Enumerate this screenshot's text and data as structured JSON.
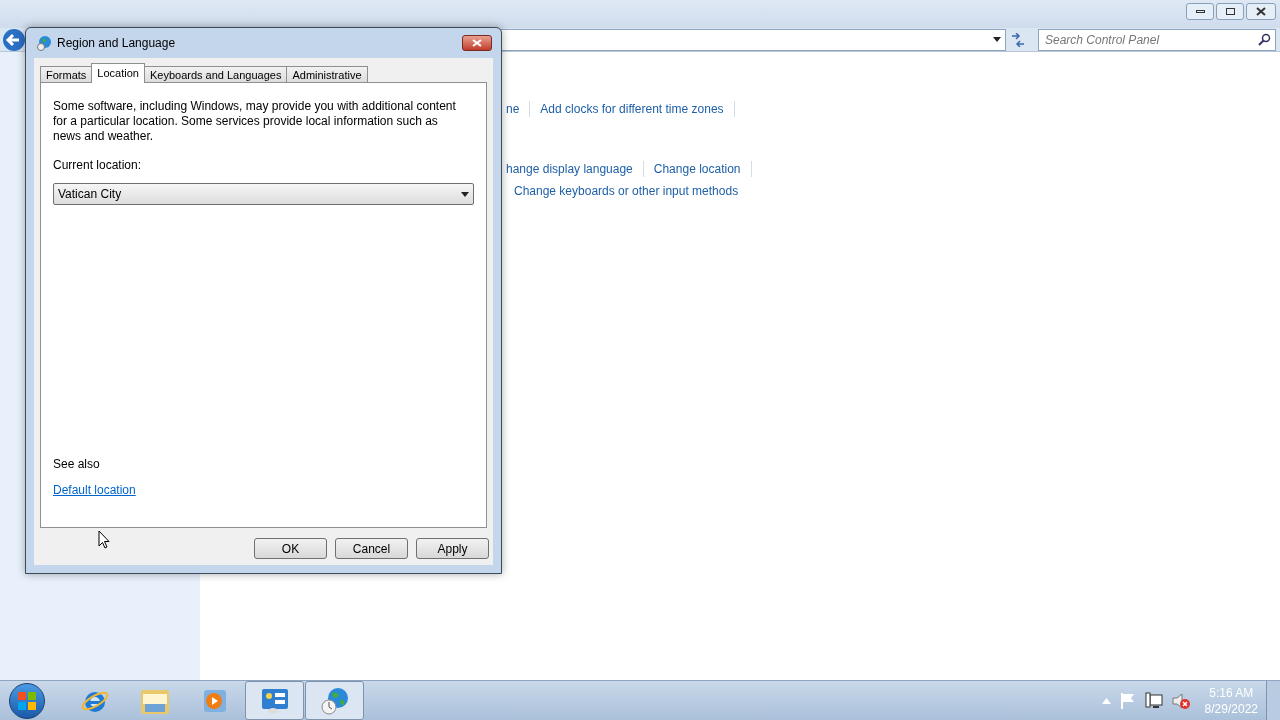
{
  "control_panel": {
    "search": {
      "placeholder": "Search Control Panel"
    },
    "link_rows": [
      {
        "links": [
          "ne",
          "Add clocks for different time zones"
        ]
      },
      {
        "links": [
          "hange display language",
          "Change location"
        ]
      },
      {
        "links": [
          "Change keyboards or other input methods"
        ]
      }
    ]
  },
  "dialog": {
    "title": "Region and Language",
    "tabs": [
      {
        "label": "Formats",
        "selected": false
      },
      {
        "label": "Location",
        "selected": true
      },
      {
        "label": "Keyboards and Languages",
        "selected": false
      },
      {
        "label": "Administrative",
        "selected": false
      }
    ],
    "description": "Some software, including Windows, may provide you with additional content for a particular location. Some services provide local information such as news and weather.",
    "current_location_label": "Current location:",
    "current_location": "Vatican City",
    "see_also": "See also",
    "see_also_link": "Default location",
    "buttons": [
      "OK",
      "Cancel",
      "Apply"
    ]
  },
  "taskbar": {
    "items": [
      {
        "kind": "browser",
        "running": false
      },
      {
        "kind": "folder",
        "running": false
      },
      {
        "kind": "media",
        "running": false
      },
      {
        "kind": "panel",
        "running": true
      },
      {
        "kind": "globe",
        "running": true
      }
    ],
    "time": "5:16 AM",
    "date": "8/29/2022"
  }
}
